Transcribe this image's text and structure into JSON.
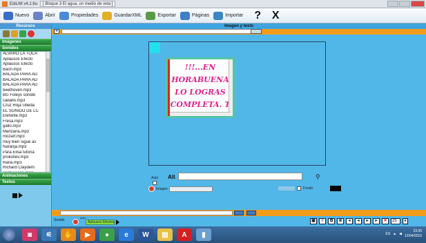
{
  "window": {
    "title": "EdiLIM v4.1.6u",
    "subtitle": "[ Bloque 3 El agua, un medio de vida ]"
  },
  "toolbar": {
    "items": [
      {
        "label": "Nuevo",
        "icon": "new-book-icon",
        "color": "#3b6cc6"
      },
      {
        "label": "Abrir",
        "icon": "open-folder-icon",
        "color": "#6a84c8"
      },
      {
        "label": "Propiedades",
        "icon": "properties-icon",
        "color": "#4a8ad8"
      },
      {
        "label": "GuardarXML",
        "icon": "save-xml-icon",
        "color": "#e2b022"
      },
      {
        "label": "Exportar",
        "icon": "export-icon",
        "color": "#5b9a4a"
      },
      {
        "label": "Páginas",
        "icon": "pages-icon",
        "color": "#3f7ec9"
      },
      {
        "label": "Importar",
        "icon": "import-icon",
        "color": "#3b86c2"
      }
    ],
    "help_label": "?",
    "close_label": "X"
  },
  "left_panel": {
    "header": "Recursos",
    "sections": {
      "images": "Imágenes",
      "sounds": "Sonidos",
      "animations": "Animaciones",
      "texts": "Textos"
    },
    "sound_files": [
      "ALVARO LA TOCA",
      "Aplausos Efecto",
      "Aplausos Efecto",
      "Bach.mp3",
      "BALADA PARA AD",
      "BALADA PARA AD",
      "BALADA PARA AD",
      "beethoven.mp3",
      "BG Foleys sonido",
      "caballo.mp3",
      "Cruz Roja Ubeda",
      "EL SONIDO DE LC",
      "Elefante.mp3",
      "Fresa.mp3",
      "gallo.mp3",
      "Manzana.mp3",
      "mozart.mp3",
      "muy bien sigue as",
      "Naranja.mp3",
      "Para Elisa tutoria",
      "prokofiev.mp3",
      "Rana.mp3",
      "Richard Claydem",
      "saint-saens.mp3"
    ]
  },
  "editor": {
    "section_title": "Imagen y texto",
    "image_text": "!!!...EN HORABUENA LO LOGRAS COMPLETA. T",
    "alt_label": "Alt",
    "alt_value": "",
    "auto_label": "Auto",
    "image_label": "Imagen",
    "image_value": "",
    "fondo_label": "Fondo",
    "fondo_color": "#000000"
  },
  "bottom": {
    "sonido_label": "Sonido",
    "auto_label": "Auto",
    "selected_sound": "Aplausos Efectos",
    "page_number": "25"
  },
  "taskbar": {
    "lang": "ES",
    "time": "23:35",
    "date": "12/04/2015"
  },
  "colors": {
    "accent_orange": "#f39c19",
    "panel_blue": "#51b6e8",
    "section_green": "#2c8f3c",
    "text_pink": "#e0218a"
  }
}
